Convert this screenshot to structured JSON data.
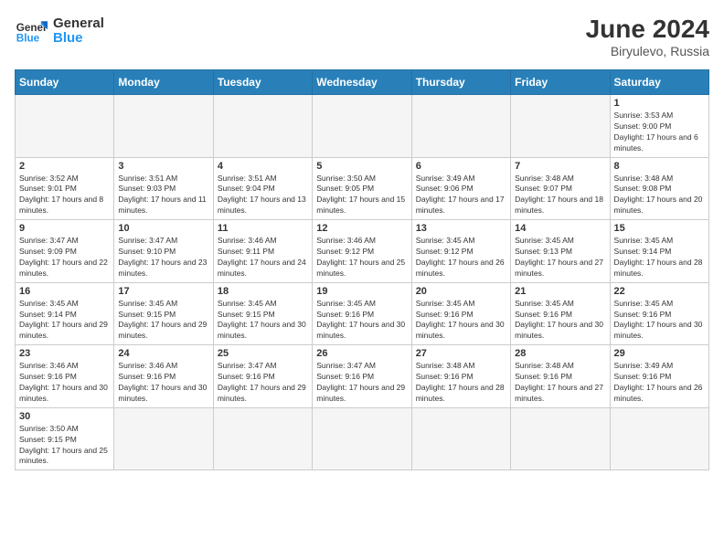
{
  "header": {
    "logo_general": "General",
    "logo_blue": "Blue",
    "month_year": "June 2024",
    "location": "Biryulevo, Russia"
  },
  "weekdays": [
    "Sunday",
    "Monday",
    "Tuesday",
    "Wednesday",
    "Thursday",
    "Friday",
    "Saturday"
  ],
  "days": {
    "1": {
      "sunrise": "3:53 AM",
      "sunset": "9:00 PM",
      "daylight": "17 hours and 6 minutes."
    },
    "2": {
      "sunrise": "3:52 AM",
      "sunset": "9:01 PM",
      "daylight": "17 hours and 8 minutes."
    },
    "3": {
      "sunrise": "3:51 AM",
      "sunset": "9:03 PM",
      "daylight": "17 hours and 11 minutes."
    },
    "4": {
      "sunrise": "3:51 AM",
      "sunset": "9:04 PM",
      "daylight": "17 hours and 13 minutes."
    },
    "5": {
      "sunrise": "3:50 AM",
      "sunset": "9:05 PM",
      "daylight": "17 hours and 15 minutes."
    },
    "6": {
      "sunrise": "3:49 AM",
      "sunset": "9:06 PM",
      "daylight": "17 hours and 17 minutes."
    },
    "7": {
      "sunrise": "3:48 AM",
      "sunset": "9:07 PM",
      "daylight": "17 hours and 18 minutes."
    },
    "8": {
      "sunrise": "3:48 AM",
      "sunset": "9:08 PM",
      "daylight": "17 hours and 20 minutes."
    },
    "9": {
      "sunrise": "3:47 AM",
      "sunset": "9:09 PM",
      "daylight": "17 hours and 22 minutes."
    },
    "10": {
      "sunrise": "3:47 AM",
      "sunset": "9:10 PM",
      "daylight": "17 hours and 23 minutes."
    },
    "11": {
      "sunrise": "3:46 AM",
      "sunset": "9:11 PM",
      "daylight": "17 hours and 24 minutes."
    },
    "12": {
      "sunrise": "3:46 AM",
      "sunset": "9:12 PM",
      "daylight": "17 hours and 25 minutes."
    },
    "13": {
      "sunrise": "3:45 AM",
      "sunset": "9:12 PM",
      "daylight": "17 hours and 26 minutes."
    },
    "14": {
      "sunrise": "3:45 AM",
      "sunset": "9:13 PM",
      "daylight": "17 hours and 27 minutes."
    },
    "15": {
      "sunrise": "3:45 AM",
      "sunset": "9:14 PM",
      "daylight": "17 hours and 28 minutes."
    },
    "16": {
      "sunrise": "3:45 AM",
      "sunset": "9:14 PM",
      "daylight": "17 hours and 29 minutes."
    },
    "17": {
      "sunrise": "3:45 AM",
      "sunset": "9:15 PM",
      "daylight": "17 hours and 29 minutes."
    },
    "18": {
      "sunrise": "3:45 AM",
      "sunset": "9:15 PM",
      "daylight": "17 hours and 30 minutes."
    },
    "19": {
      "sunrise": "3:45 AM",
      "sunset": "9:16 PM",
      "daylight": "17 hours and 30 minutes."
    },
    "20": {
      "sunrise": "3:45 AM",
      "sunset": "9:16 PM",
      "daylight": "17 hours and 30 minutes."
    },
    "21": {
      "sunrise": "3:45 AM",
      "sunset": "9:16 PM",
      "daylight": "17 hours and 30 minutes."
    },
    "22": {
      "sunrise": "3:45 AM",
      "sunset": "9:16 PM",
      "daylight": "17 hours and 30 minutes."
    },
    "23": {
      "sunrise": "3:46 AM",
      "sunset": "9:16 PM",
      "daylight": "17 hours and 30 minutes."
    },
    "24": {
      "sunrise": "3:46 AM",
      "sunset": "9:16 PM",
      "daylight": "17 hours and 30 minutes."
    },
    "25": {
      "sunrise": "3:47 AM",
      "sunset": "9:16 PM",
      "daylight": "17 hours and 29 minutes."
    },
    "26": {
      "sunrise": "3:47 AM",
      "sunset": "9:16 PM",
      "daylight": "17 hours and 29 minutes."
    },
    "27": {
      "sunrise": "3:48 AM",
      "sunset": "9:16 PM",
      "daylight": "17 hours and 28 minutes."
    },
    "28": {
      "sunrise": "3:48 AM",
      "sunset": "9:16 PM",
      "daylight": "17 hours and 27 minutes."
    },
    "29": {
      "sunrise": "3:49 AM",
      "sunset": "9:16 PM",
      "daylight": "17 hours and 26 minutes."
    },
    "30": {
      "sunrise": "3:50 AM",
      "sunset": "9:15 PM",
      "daylight": "17 hours and 25 minutes."
    }
  },
  "labels": {
    "sunrise": "Sunrise:",
    "sunset": "Sunset:",
    "daylight": "Daylight:"
  }
}
